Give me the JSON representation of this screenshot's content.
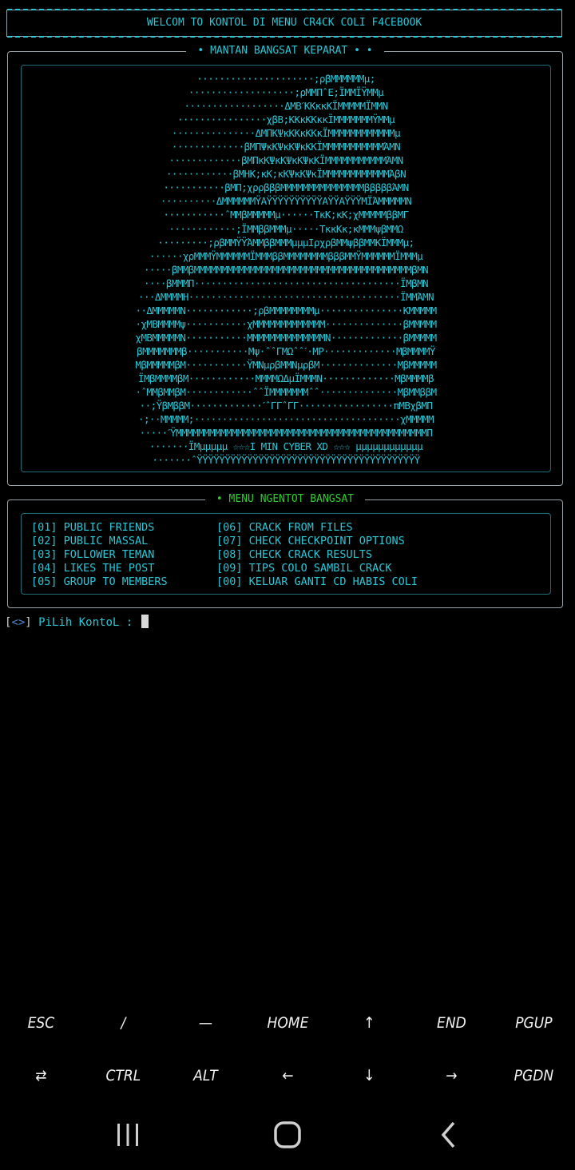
{
  "header": {
    "title": "WELCOM TO KONTOL DI MENU CR4CK COLI F4CEBOOK"
  },
  "art_panel": {
    "title": "• MANTAN BANGSAT KEPARAT • •",
    "art_lines": [
      "·····················;ρβMMMMMMμ;",
      "···················;ρMMΠˆΕ;ÏMMÏŸMMμ",
      "··················ΔMBˊKKκκKÏMMMMMÏMMN",
      "················χβB;KKκKKκκÏMMMMMMMŸMMμ",
      "···············ΔMΠKΨκKKκKKκÏMMMMMMMMMMMMμ",
      "·············βMΠΨκKΨκKΨκKKÏMMMMMMMMMMMΆMN",
      "·············βMΠκKΨκKΨκKΨκKÏMMMMMMMMMMMΆMN",
      "············βMHK;κK;κKΨκKΨκÏMMMMMMMMMMMMΆβN",
      "···········βMΠ;χρρβββMMMMMMMMMMMMMMMβββββΆMN",
      "··········ΔMMMMMMŸΑŸŸŸŸŸŸŸŸŸŸΑŸŸΑŸŸŸMÏΆMMMMMN",
      "···········ˆMMβMMMMMμ······TκK;κK;χMMMMMββMΓ",
      "············;ÏMMββMMMμ·····TκκKκ;κMMMψβMMΩ",
      "·········;ρβMMŸŸΆMMββMMMμμμIρχρβMMψββMMKÏMMMμ;",
      "······χρMMMŸMMMMMMÏMMMββMMMMMMMMβββMMŸMMMMMMÏMMMμ",
      "·····βMMβMMMMMMMMMMMMMMMMMMMMMMMMMMMMMMMMMMMMMMMβMN",
      "····βMMMΠ·····································ÏMβMN",
      "···ΔMMMMH······································ÏMMΆMN",
      "··ΔMMMMMN············;ρβMMMMMMMMμ···············KMMMMM",
      "·χMBMMMMψ···········χMMMMMMMMMMMMM··············βMMMMM",
      "χMBMMMMMN···········MMMMMMMMMMMMMMN·············βMMMMM",
      "βMMMMMMMβ···········Mψ·ˆˆΓMΩˆˆˊ·MP·············MβMMMMŸ",
      "MβMMMMMβM···········ŸMNμρβMMNμρβM··············MβMMMMM",
      "ÏMβMMMMβM············MMMMΩΔμÏMMMN·············MβMMMMβ",
      "·ˆMMβMMβM············ˆˆÏMMMMMMMˆˆ··············MβMMββM",
      "··;ŸβMββM·············ˊˆΓΓˆΓΓ·················πMBχβMΠ",
      "·;··MMMMM;·····································χMMMMM",
      "·····ˊŸMMMMMMMMMMMMMMMMMMMMMMMMMMMMMMMMMMMMMMMMMMMMMΠ",
      "·······ÏMμμμμμ ☆☆☆I MIN CYBER XD ☆☆☆ μμμμμμμμμμμμ",
      "·······ˆŸŸŸŸŸŸŸŸŸŸŸŸŸŸŸŸŸŸŸŸŸŸŸŸŸŸŸŸŸŸŸŸŸŸŸŸŸŸŸŸ"
    ]
  },
  "menu_panel": {
    "title": "• MENU NGENTOT BANGSAT",
    "left": [
      "[01] PUBLIC FRIENDS",
      "[02] PUBLIC MASSAL",
      "[03] FOLLOWER TEMAN",
      "[04] LIKES THE POST",
      "[05] GROUP TO MEMBERS"
    ],
    "right": [
      "[06] CRACK FROM FILES",
      "[07] CHECK CHECKPOINT OPTIONS",
      "[08] CHECK CRACK RESULTS",
      "[09] TIPS COLO SAMBIL CRACK",
      "[00] KELUAR GANTI CD HABIS COLI"
    ]
  },
  "prompt": {
    "open": "[",
    "symbol": "<>",
    "close": "]",
    "label": " PiLih KontoL : "
  },
  "extra_keys": {
    "row1": [
      "ESC",
      "/",
      "—",
      "HOME",
      "↑",
      "END",
      "PGUP"
    ],
    "row2": [
      "⇄",
      "CTRL",
      "ALT",
      "←",
      "↓",
      "→",
      "PGDN"
    ]
  },
  "colors": {
    "cyan_text": "#28c8d8",
    "green_title": "#2bd02b",
    "border": "#9aa3a8",
    "background": "#000000"
  },
  "nav_icons": [
    "recent-apps-icon",
    "home-icon",
    "back-icon"
  ]
}
